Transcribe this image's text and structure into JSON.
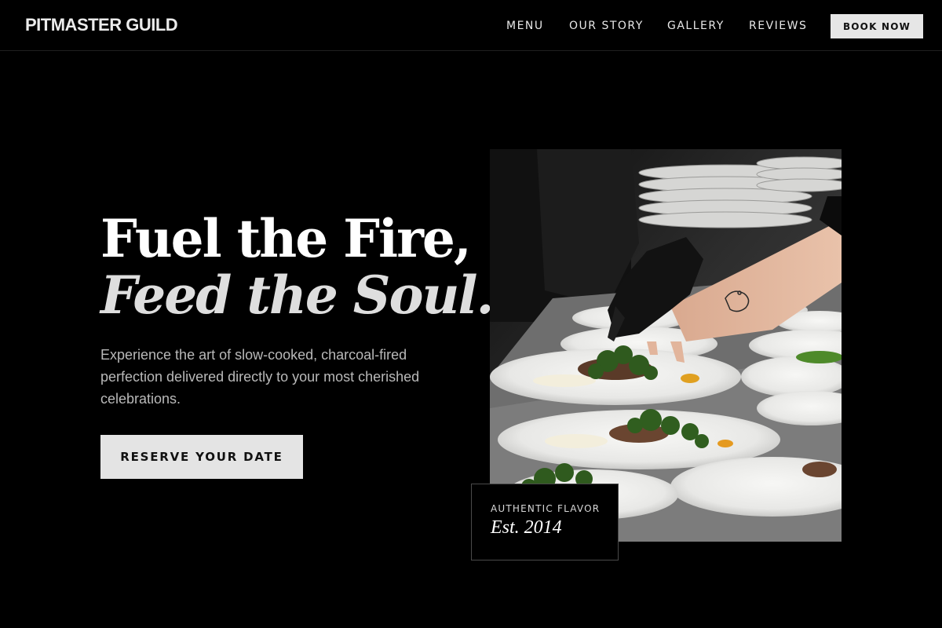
{
  "header": {
    "brand": "PITMASTER GUILD",
    "nav": [
      "MENU",
      "OUR STORY",
      "GALLERY",
      "REVIEWS"
    ],
    "book_label": "BOOK NOW"
  },
  "hero": {
    "title_line1": "Fuel the Fire,",
    "title_line2": "Feed the Soul.",
    "subtitle": "Experience the art of slow-cooked, charcoal-fired perfection delivered directly to your most cherished celebrations.",
    "cta_label": "RESERVE YOUR DATE"
  },
  "badge": {
    "caption": "AUTHENTIC FLAVOR",
    "year": "Est. 2014"
  },
  "colors": {
    "background": "#000000",
    "button": "#e4e4e4",
    "button_text": "#111111",
    "muted_text": "#b9b9b9"
  }
}
